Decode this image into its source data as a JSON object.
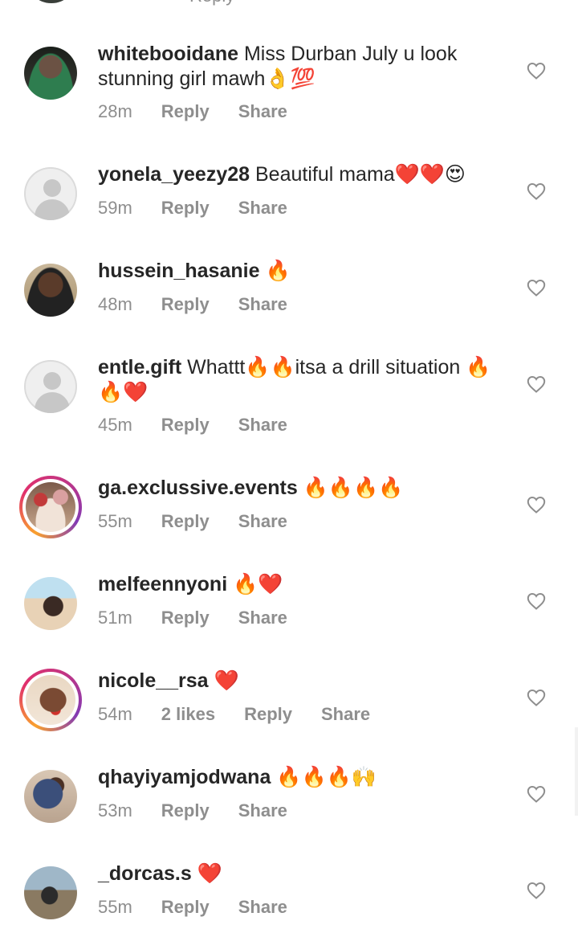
{
  "top_partial": {
    "reply_label": "Reply"
  },
  "comments": [
    {
      "username": "whitebooidane",
      "text": "Miss Durban July u look stunning girl mawh👌💯",
      "time": "28m",
      "likes": "",
      "reply": "Reply",
      "share": "Share",
      "avatar": "photo",
      "story": false
    },
    {
      "username": "yonela_yeezy28",
      "text": "Beautiful mama❤️❤️😍",
      "time": "59m",
      "likes": "",
      "reply": "Reply",
      "share": "Share",
      "avatar": "default",
      "story": false
    },
    {
      "username": "hussein_hasanie",
      "text": "🔥",
      "time": "48m",
      "likes": "",
      "reply": "Reply",
      "share": "Share",
      "avatar": "photo",
      "story": false
    },
    {
      "username": "entle.gift",
      "text": "Whattt🔥🔥itsa a drill situation 🔥🔥❤️",
      "time": "45m",
      "likes": "",
      "reply": "Reply",
      "share": "Share",
      "avatar": "default",
      "story": false
    },
    {
      "username": "ga.exclussive.events",
      "text": "🔥🔥🔥🔥",
      "time": "55m",
      "likes": "",
      "reply": "Reply",
      "share": "Share",
      "avatar": "photo",
      "story": true
    },
    {
      "username": "melfeennyoni",
      "text": "🔥❤️",
      "time": "51m",
      "likes": "",
      "reply": "Reply",
      "share": "Share",
      "avatar": "photo",
      "story": false
    },
    {
      "username": "nicole__rsa",
      "text": "❤️",
      "time": "54m",
      "likes": "2 likes",
      "reply": "Reply",
      "share": "Share",
      "avatar": "photo",
      "story": true
    },
    {
      "username": "qhayiyamjodwana",
      "text": "🔥🔥🔥🙌",
      "time": "53m",
      "likes": "",
      "reply": "Reply",
      "share": "Share",
      "avatar": "photo",
      "story": false
    },
    {
      "username": "_dorcas.s",
      "text": "❤️",
      "time": "55m",
      "likes": "",
      "reply": "Reply",
      "share": "Share",
      "avatar": "photo",
      "story": false
    }
  ],
  "colors": {
    "text": "#262626",
    "secondary": "#8e8e8e",
    "background": "#ffffff"
  },
  "icons": {
    "like": "heart-outline-icon",
    "default_avatar": "default-user-icon"
  }
}
